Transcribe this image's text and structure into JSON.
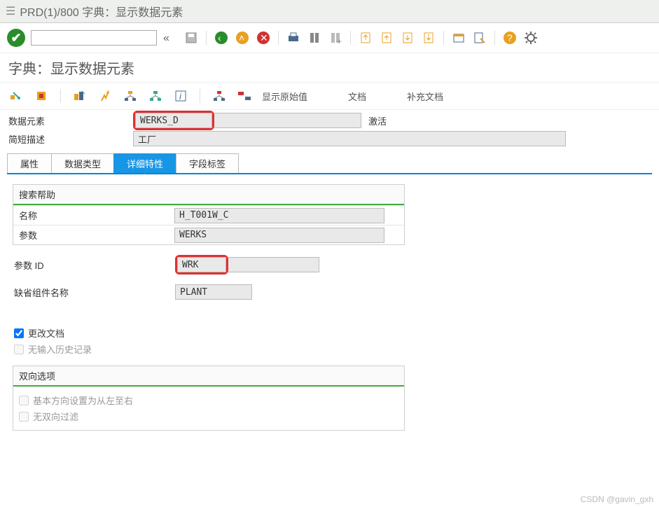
{
  "window": {
    "title": "PRD(1)/800 字典：显示数据元素"
  },
  "subtitle": "字典：显示数据元素",
  "app_toolbar": {
    "show_original": "显示原始值",
    "doc": "文档",
    "supp_doc": "补充文档"
  },
  "form": {
    "data_element_label": "数据元素",
    "data_element_value": "WERKS_D",
    "status": "激活",
    "short_desc_label": "简短描述",
    "short_desc_value": "工厂"
  },
  "tabs": {
    "t1": "属性",
    "t2": "数据类型",
    "t3": "详细特性",
    "t4": "字段标签"
  },
  "search_help": {
    "title": "搜索帮助",
    "name_label": "名称",
    "name_value": "H_T001W_C",
    "param_label": "参数",
    "param_value": "WERKS"
  },
  "param_id": {
    "label": "参数 ID",
    "value": "WRK"
  },
  "default_comp": {
    "label": "缺省组件名称",
    "value": "PLANT"
  },
  "checks": {
    "change_doc": "更改文档",
    "no_history": "无输入历史记录"
  },
  "bidi": {
    "title": "双向选项",
    "ltr": "基本方向设置为从左至右",
    "nofilter": "无双向过滤"
  },
  "watermark": "CSDN @gavin_gxh"
}
